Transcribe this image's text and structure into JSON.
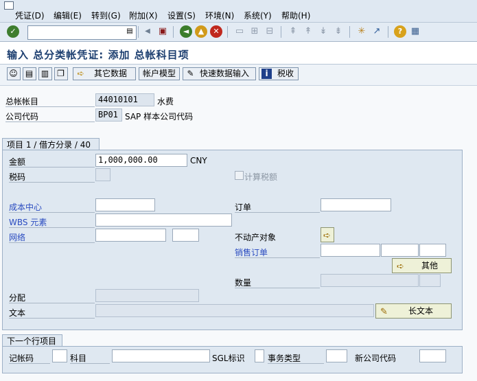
{
  "menu": [
    "凭证(D)",
    "编辑(E)",
    "转到(G)",
    "附加(X)",
    "设置(S)",
    "环境(N)",
    "系统(Y)",
    "帮助(H)"
  ],
  "toolbar": {
    "command_value": ""
  },
  "title": "输入 总分类帐凭证: 添加 总帐科目项",
  "app_toolbar": {
    "other_data": "其它数据",
    "account_model": "帐户模型",
    "fast_entry": "快速数据输入",
    "tax": "税收"
  },
  "header": {
    "gl_account_label": "总帐帐目",
    "gl_account_value": "44010101",
    "gl_account_desc": "水费",
    "company_code_label": "公司代码",
    "company_code_value": "BP01",
    "company_code_desc": "SAP 样本公司代码"
  },
  "item_group": {
    "title": "项目 1 / 借方分录 / 40",
    "amount_label": "金额",
    "amount_value": "1,000,000.00",
    "currency": "CNY",
    "tax_code_label": "税码",
    "calc_tax_label": "计算税额",
    "calc_tax_checked": false,
    "cost_center_label": "成本中心",
    "wbs_label": "WBS 元素",
    "network_label": "网络",
    "order_label": "订单",
    "real_estate_label": "不动产对象",
    "sales_order_label": "销售订单",
    "other_button": "其他",
    "quantity_label": "数量",
    "assignment_label": "分配",
    "text_label": "文本",
    "long_text_button": "长文本"
  },
  "next_item": {
    "title": "下一个行项目",
    "posting_key_label": "记帐码",
    "account_label": "科目",
    "sgl_label": "SGL标识",
    "trans_type_label": "事务类型",
    "new_company_label": "新公司代码"
  },
  "colors": {
    "menubar_bg": "#dfe8f2",
    "title_text": "#1d3f70",
    "link_label": "#2a4bc0",
    "group_bg": "#dfe8f1",
    "pushbutton_bg": "#eef1d8"
  },
  "icons": [
    "system-menu-icon",
    "enter-check-icon",
    "back-icon",
    "exit-icon",
    "cancel-icon",
    "print-icon",
    "find-icon",
    "find-next-icon",
    "first-page-icon",
    "previous-page-icon",
    "next-page-icon",
    "last-page-icon",
    "create-session-icon",
    "shortcut-icon",
    "help-icon",
    "layout-icon"
  ]
}
